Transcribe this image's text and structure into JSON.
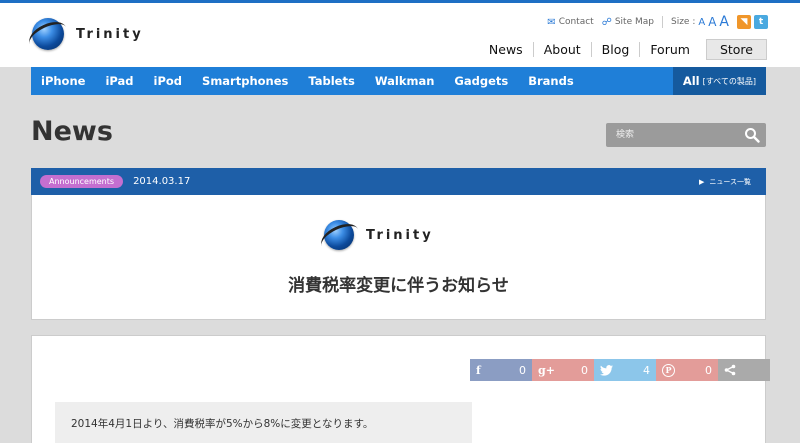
{
  "logo": {
    "name": "Trinity"
  },
  "utility": {
    "contact": "Contact",
    "sitemap": "Site Map",
    "size_label": "Size :",
    "size_letters": [
      "A",
      "A",
      "A"
    ]
  },
  "mainnav": [
    "News",
    "About",
    "Blog",
    "Forum"
  ],
  "store_label": "Store",
  "categories": [
    "iPhone",
    "iPad",
    "iPod",
    "Smartphones",
    "Tablets",
    "Walkman",
    "Gadgets",
    "Brands"
  ],
  "all": {
    "label": "All",
    "sub": "[すべての製品]"
  },
  "page_title": "News",
  "search": {
    "placeholder": "検索"
  },
  "news": {
    "badge": "Announcements",
    "date": "2014.03.17",
    "list_link": "ニュース一覧"
  },
  "article": {
    "title": "消費税率変更に伴うお知らせ",
    "body": "2014年4月1日より、消費税率が5%から8%に変更となります。"
  },
  "share": [
    {
      "icon": "facebook-icon",
      "glyph": "f",
      "count": "0"
    },
    {
      "icon": "googleplus-icon",
      "glyph": "g+",
      "count": "0"
    },
    {
      "icon": "twitter-icon",
      "glyph": "🐦",
      "count": "4"
    },
    {
      "icon": "pinterest-icon",
      "glyph": "P",
      "count": "0"
    },
    {
      "icon": "share-icon",
      "glyph": "<",
      "count": ""
    }
  ]
}
